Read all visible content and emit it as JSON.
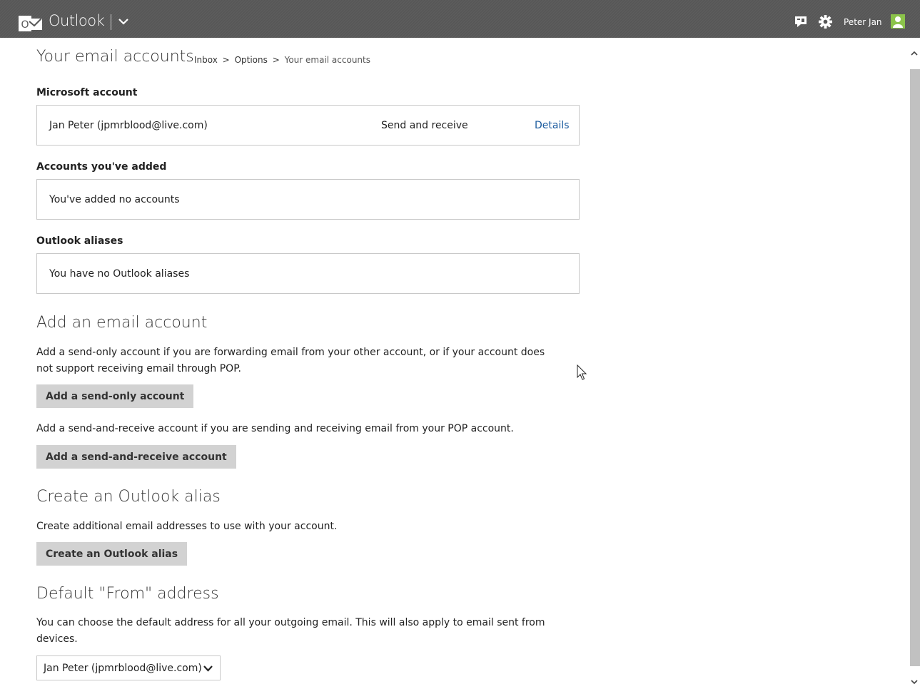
{
  "topbar": {
    "app_name": "Outlook",
    "logo_letter": "O",
    "user_name": "Peter Jan",
    "colors": {
      "bar": "#565656",
      "avatar": "#8bc34a"
    },
    "icons": [
      "outlook-logo-icon",
      "chevron-down-icon",
      "chat-icon",
      "gear-icon",
      "avatar-icon"
    ]
  },
  "page": {
    "title": "Your email accounts",
    "breadcrumb": {
      "inbox": "Inbox",
      "sep": ">",
      "options": "Options",
      "current": "Your email accounts"
    }
  },
  "microsoft_account": {
    "label": "Microsoft account",
    "name": "Jan Peter (jpmrblood@live.com)",
    "mode": "Send and receive",
    "details_link": "Details"
  },
  "added_accounts": {
    "label": "Accounts you've added",
    "empty_text": "You've added no accounts"
  },
  "aliases": {
    "label": "Outlook aliases",
    "empty_text": "You have no Outlook aliases"
  },
  "add_account": {
    "heading": "Add an email account",
    "send_only_desc": "Add a send-only account if you are forwarding email from your other account, or if your account does not support receiving email through POP.",
    "send_only_button": "Add a send-only account",
    "send_receive_desc": "Add a send-and-receive account if you are sending and receiving email from your POP account.",
    "send_receive_button": "Add a send-and-receive account"
  },
  "create_alias": {
    "heading": "Create an Outlook alias",
    "desc": "Create additional email addresses to use with your account.",
    "button": "Create an Outlook alias"
  },
  "default_from": {
    "heading": "Default \"From\" address",
    "desc": "You can choose the default address for all your outgoing email. This will also apply to email sent from devices.",
    "selected": "Jan Peter (jpmrblood@live.com)"
  }
}
